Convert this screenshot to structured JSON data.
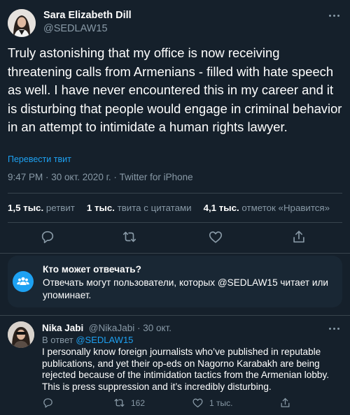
{
  "tweet": {
    "author_name": "Sara Elizabeth Dill",
    "author_handle": "@SEDLAW15",
    "text": "Truly astonishing that my office is now receiving threatening calls from Armenians - filled with hate speech as well. I have never encountered this in my career and it is disturbing that people would engage in criminal behavior in an attempt to intimidate a human rights lawyer.",
    "translate_label": "Перевести твит",
    "timestamp": "9:47 PM · 30 окт. 2020 г. · Twitter for iPhone"
  },
  "stats": {
    "retweets_value": "1,5 тыс.",
    "retweets_label": "ретвит",
    "quotes_value": "1 тыс.",
    "quotes_label": "твита с цитатами",
    "likes_value": "4,1 тыс.",
    "likes_label": "отметок «Нравится»"
  },
  "actions": {
    "icons": [
      "reply-icon",
      "retweet-icon",
      "like-icon",
      "share-icon"
    ]
  },
  "reply_restriction": {
    "title": "Кто может отвечать?",
    "body": "Отвечать могут пользователи, которых @SEDLAW15 читает или упоминает."
  },
  "reply": {
    "author_name": "Nika Jabi",
    "author_handle": "@NikaJabi · 30 окт.",
    "in_reply_prefix": "В ответ",
    "in_reply_handle": "@SEDLAW15",
    "text": "I personally know foreign journalists who’ve published in reputable publications, and yet their op-eds on Nagorno Karabakh are being rejected because of the intimidation tactics from the Armenian lobby. This is press suppression and it’s incredibly disturbing.",
    "retweet_count": "162",
    "like_count": "1 тыс."
  },
  "colors": {
    "background": "#15202b",
    "card": "#192734",
    "accent": "#1da1f2",
    "secondary_text": "#8899a6",
    "divider": "#38444d"
  }
}
